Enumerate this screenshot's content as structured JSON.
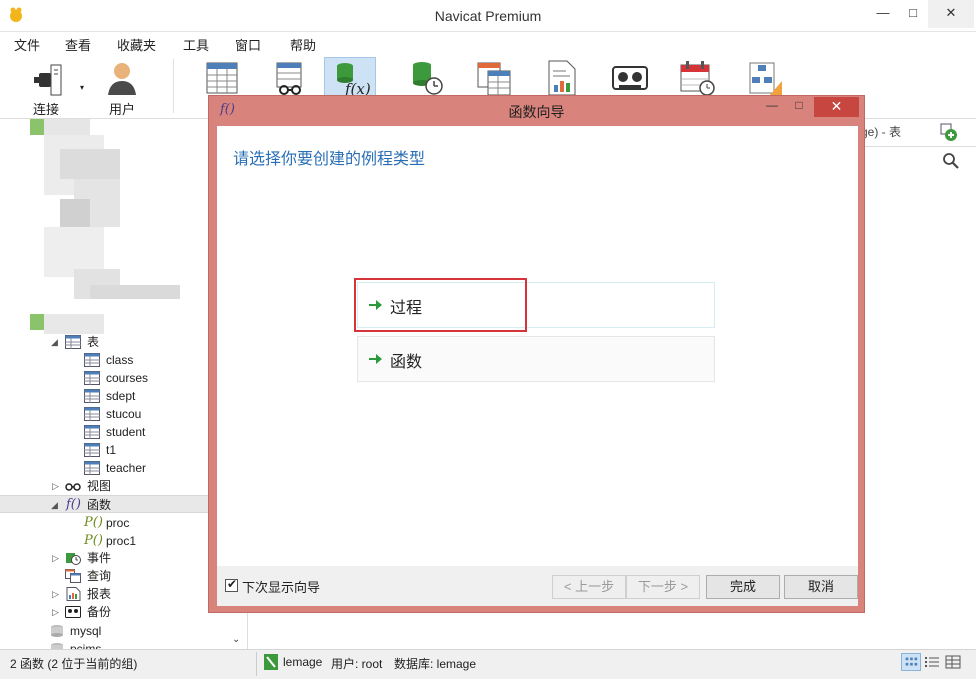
{
  "app": {
    "title": "Navicat Premium",
    "window_controls": {
      "minimize": "—",
      "maximize": "□",
      "close": "✕"
    }
  },
  "menu": [
    "文件",
    "查看",
    "收藏夹",
    "工具",
    "窗口",
    "帮助"
  ],
  "toolbar": {
    "connect_label": "连接",
    "user_label": "用户",
    "buttons": [
      "table-icon",
      "view-icon",
      "function-icon",
      "event-icon",
      "query-icon",
      "report-icon",
      "backup-icon",
      "schedule-icon",
      "model-icon"
    ],
    "active": "function-icon"
  },
  "sidebar": {
    "tables_label": "表",
    "tables": [
      "class",
      "courses",
      "sdept",
      "stucou",
      "student",
      "t1",
      "teacher"
    ],
    "views_label": "视图",
    "functions_label": "函数",
    "functions": [
      "proc",
      "proc1"
    ],
    "events_label": "事件",
    "queries_label": "查询",
    "reports_label": "报表",
    "backups_label": "备份",
    "other_dbs": [
      "mysql",
      "pcims"
    ]
  },
  "right_panel": {
    "tab_label": "ge) - 表"
  },
  "dialog": {
    "title": "函数向导",
    "heading": "请选择你要创建的例程类型",
    "options": [
      "过程",
      "函数"
    ],
    "highlighted_option": "过程",
    "show_next_time_label": "下次显示向导",
    "show_next_time_checked": true,
    "prev_button": "< 上一步",
    "next_button": "下一步 >",
    "finish_button": "完成",
    "cancel_button": "取消"
  },
  "status": {
    "left": "2 函数 (2 位于当前的组)",
    "connection": "lemage",
    "user": "用户: root",
    "database": "数据库: lemage"
  },
  "colors": {
    "dialog_frame": "#d8837c",
    "close_button": "#c7463f",
    "heading_blue": "#2a6fb5",
    "highlight_red": "#d7343a",
    "arrow_green": "#2a9a3c"
  }
}
